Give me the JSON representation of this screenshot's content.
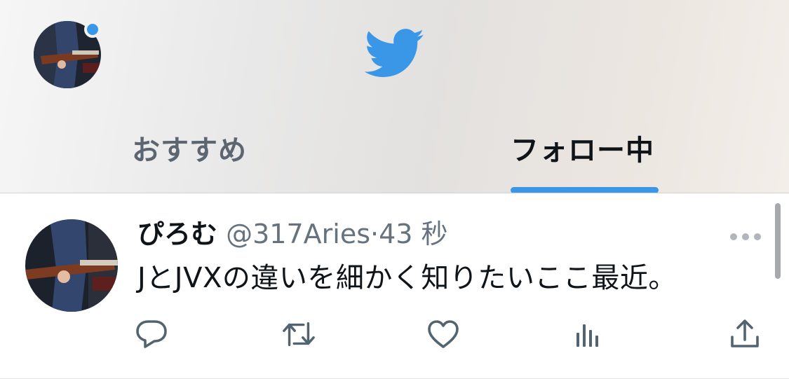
{
  "tabs": [
    {
      "label": "おすすめ"
    },
    {
      "label": "フォロー中"
    }
  ],
  "tweet": {
    "display_name": "ぴろむ",
    "handle": "@317Aries",
    "separator": "·",
    "time": "43 秒",
    "text": "JとJVXの違いを細かく知りたいここ最近。"
  },
  "colors": {
    "accent": "#3a97e8",
    "text_primary": "#0f1419",
    "text_secondary": "#66727d"
  },
  "icons": {
    "logo": "twitter-bird-icon",
    "reply": "reply-icon",
    "retweet": "retweet-icon",
    "like": "heart-icon",
    "views": "analytics-icon",
    "share": "share-icon",
    "more": "more-icon"
  }
}
